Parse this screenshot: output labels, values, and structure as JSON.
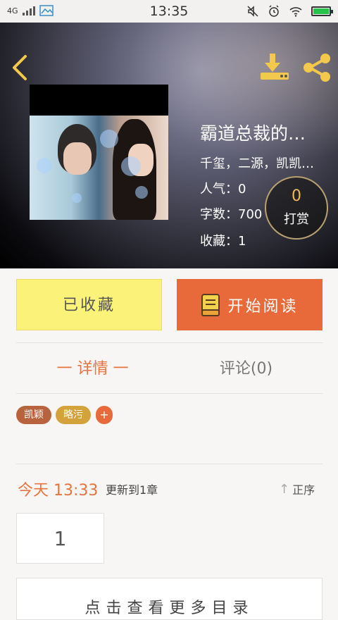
{
  "status_bar": {
    "network": "4G",
    "time": "13:35"
  },
  "book": {
    "title": "霸道总裁的…",
    "author": "千玺，二源，凯凯…",
    "popularity": "人气：0",
    "word_count": "字数：700",
    "favorites": "收藏：1",
    "reward_count": "0",
    "reward_label": "打赏"
  },
  "actions": {
    "favorite_label": "已收藏",
    "read_label": "开始阅读"
  },
  "tabs": [
    {
      "label": "一 详情 一",
      "active": true
    },
    {
      "label": "评论(0)",
      "active": false
    }
  ],
  "tags": [
    {
      "label": "凯颖",
      "color": "#b8623e"
    },
    {
      "label": "略污",
      "color": "#d4a23a"
    },
    {
      "label": "+",
      "color": "#e86a3a"
    }
  ],
  "update": {
    "time": "今天 13:33",
    "text": "更新到1章",
    "sort_label": "正序"
  },
  "chapters": [
    "1"
  ],
  "bottom_hint": "点击查看更多目录",
  "colors": {
    "accent": "#e86a3a",
    "favorite_bg": "#fbf279",
    "tab_active": "#e8733e"
  }
}
